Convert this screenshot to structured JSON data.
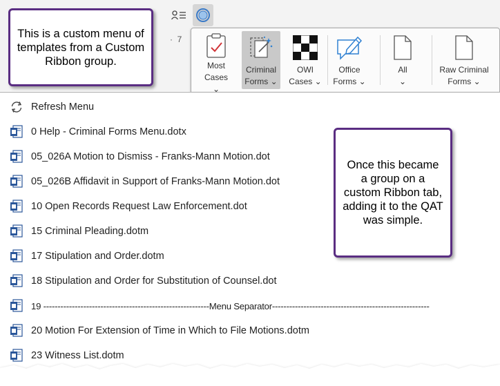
{
  "qat": {
    "ruler_number": "7"
  },
  "ribbon": {
    "buttons": [
      {
        "line1": "Most",
        "line2": "Cases ⌄"
      },
      {
        "line1": "Criminal",
        "line2": "Forms ⌄"
      },
      {
        "line1": "OWI",
        "line2": "Cases ⌄"
      },
      {
        "line1": "Office",
        "line2": "Forms ⌄"
      },
      {
        "line1": "All",
        "line2": "⌄"
      },
      {
        "line1": "Raw Criminal",
        "line2": "Forms ⌄"
      }
    ],
    "active_index": 1
  },
  "menu": {
    "items": [
      {
        "label": "Refresh Menu",
        "icon": "refresh-icon"
      },
      {
        "label": "0 Help - Criminal Forms Menu.dotx",
        "icon": "word-template-icon"
      },
      {
        "label": "05_026A Motion to Dismiss - Franks-Mann Motion.dot",
        "icon": "word-template-icon"
      },
      {
        "label": "05_026B Affidavit in Support of Franks-Mann Motion.dot",
        "icon": "word-template-icon"
      },
      {
        "label": "10 Open Records Request Law Enforcement.dot",
        "icon": "word-template-icon"
      },
      {
        "label": "15 Criminal Pleading.dotm",
        "icon": "word-template-icon"
      },
      {
        "label": "17 Stipulation and Order.dotm",
        "icon": "word-template-icon"
      },
      {
        "label": "18 Stipulation and Order for Substitution of Counsel.dot",
        "icon": "word-template-icon"
      },
      {
        "label": "19 ----------------------------------------------------------Menu Separator-------------------------------------------------------",
        "icon": "word-template-icon"
      },
      {
        "label": "20 Motion  For Extension of Time in Which to File Motions.dotm",
        "icon": "word-template-icon"
      },
      {
        "label": "23 Witness List.dotm",
        "icon": "word-template-icon"
      }
    ]
  },
  "callouts": {
    "top_left": "This is a custom menu of templates from a Custom Ribbon group.",
    "right": "Once this became a group on a custom Ribbon tab, adding it to the QAT was simple."
  },
  "colors": {
    "callout_border": "#5a2d82",
    "word_blue": "#2b579a",
    "ribbon_active": "#c9c9c9"
  }
}
